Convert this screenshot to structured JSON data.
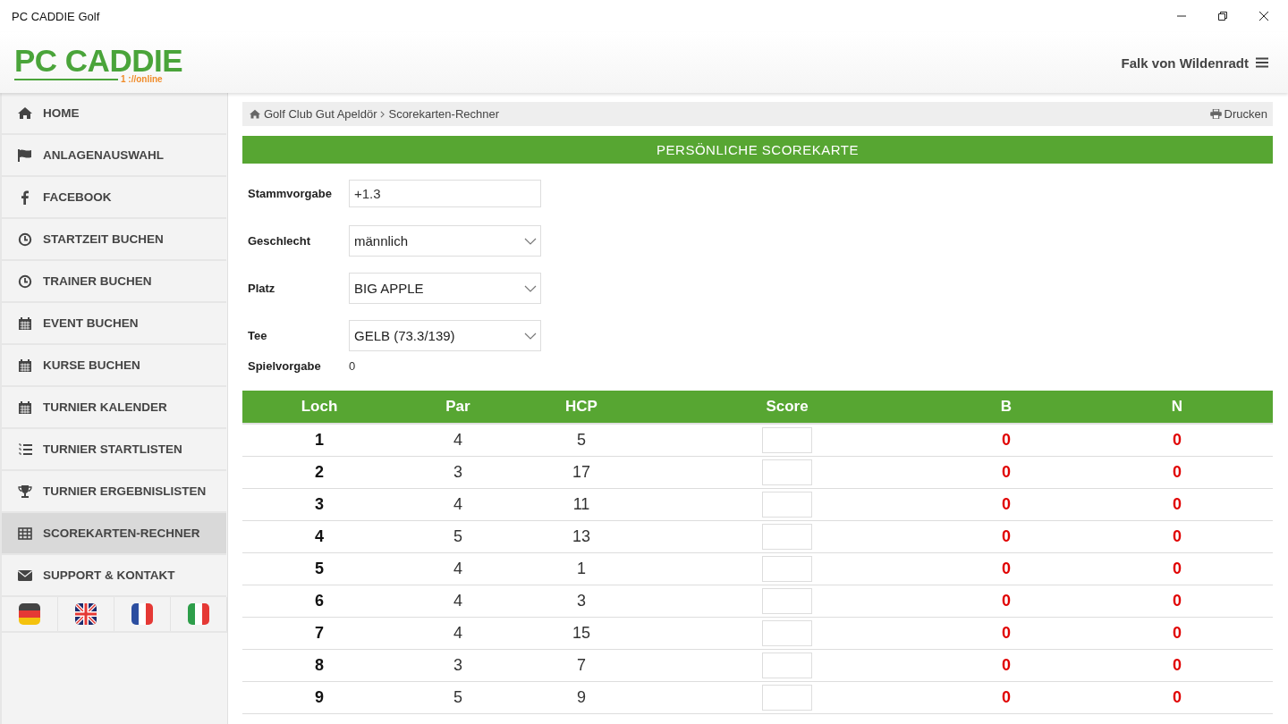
{
  "window": {
    "title": "PC CADDIE Golf"
  },
  "header": {
    "logo": "PC CADDIE",
    "logo_tag": "1 ://online",
    "user": "Falk von Wildenradt"
  },
  "sidebar": {
    "items": [
      {
        "label": "HOME",
        "selected": false
      },
      {
        "label": "ANLAGENAUSWAHL",
        "selected": false
      },
      {
        "label": "FACEBOOK",
        "selected": false
      },
      {
        "label": "STARTZEIT BUCHEN",
        "selected": false
      },
      {
        "label": "TRAINER BUCHEN",
        "selected": false
      },
      {
        "label": "EVENT BUCHEN",
        "selected": false
      },
      {
        "label": "KURSE BUCHEN",
        "selected": false
      },
      {
        "label": "TURNIER KALENDER",
        "selected": false
      },
      {
        "label": "TURNIER STARTLISTEN",
        "selected": false
      },
      {
        "label": "TURNIER ERGEBNISLISTEN",
        "selected": false
      },
      {
        "label": "SCOREKARTEN-RECHNER",
        "selected": true
      },
      {
        "label": "SUPPORT & KONTAKT",
        "selected": false
      }
    ]
  },
  "breadcrumb": {
    "items": [
      "Golf Club Gut Apeldör",
      "Scorekarten-Rechner"
    ],
    "print": "Drucken"
  },
  "card": {
    "title": "PERSÖNLICHE SCOREKARTE",
    "fields": [
      {
        "kind": "input",
        "label": "Stammvorgabe",
        "value": "+1.3"
      },
      {
        "kind": "select",
        "label": "Geschlecht",
        "value": "männlich"
      },
      {
        "kind": "select",
        "label": "Platz",
        "value": "BIG APPLE"
      },
      {
        "kind": "select",
        "label": "Tee",
        "value": "GELB (73.3/139)"
      },
      {
        "kind": "text",
        "label": "Spielvorgabe",
        "value": "0"
      }
    ]
  },
  "table": {
    "columns": [
      "Loch",
      "Par",
      "HCP",
      "Score",
      "B",
      "N"
    ],
    "rows": [
      {
        "loch": "1",
        "par": "4",
        "hcp": "5",
        "b": "0",
        "n": "0"
      },
      {
        "loch": "2",
        "par": "3",
        "hcp": "17",
        "b": "0",
        "n": "0"
      },
      {
        "loch": "3",
        "par": "4",
        "hcp": "11",
        "b": "0",
        "n": "0"
      },
      {
        "loch": "4",
        "par": "5",
        "hcp": "13",
        "b": "0",
        "n": "0"
      },
      {
        "loch": "5",
        "par": "4",
        "hcp": "1",
        "b": "0",
        "n": "0"
      },
      {
        "loch": "6",
        "par": "4",
        "hcp": "3",
        "b": "0",
        "n": "0"
      },
      {
        "loch": "7",
        "par": "4",
        "hcp": "15",
        "b": "0",
        "n": "0"
      },
      {
        "loch": "8",
        "par": "3",
        "hcp": "7",
        "b": "0",
        "n": "0"
      },
      {
        "loch": "9",
        "par": "5",
        "hcp": "9",
        "b": "0",
        "n": "0"
      }
    ]
  }
}
